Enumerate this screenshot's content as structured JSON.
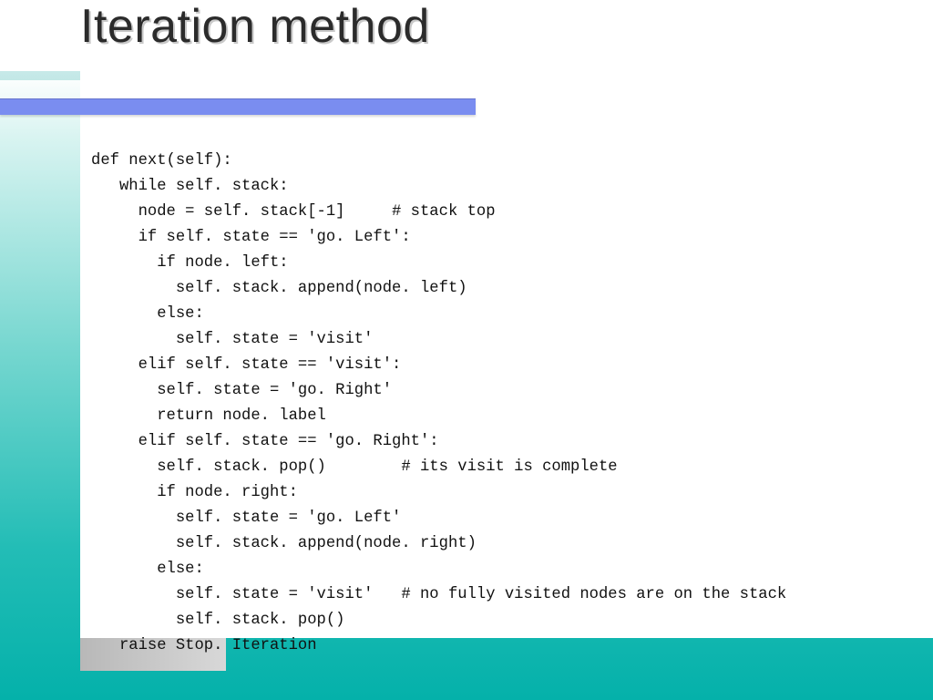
{
  "slide": {
    "title": "Iteration method"
  },
  "code": {
    "lines": [
      "def next(self):",
      "   while self. stack:",
      "     node = self. stack[-1]     # stack top",
      "     if self. state == 'go. Left':",
      "       if node. left:",
      "         self. stack. append(node. left)",
      "       else:",
      "         self. state = 'visit'",
      "     elif self. state == 'visit':",
      "       self. state = 'go. Right'",
      "       return node. label",
      "     elif self. state == 'go. Right':",
      "       self. stack. pop()        # its visit is complete",
      "       if node. right:",
      "         self. state = 'go. Left'",
      "         self. stack. append(node. right)",
      "       else:",
      "         self. state = 'visit'   # no fully visited nodes are on the stack",
      "         self. stack. pop()",
      "   raise Stop. Iteration"
    ]
  }
}
